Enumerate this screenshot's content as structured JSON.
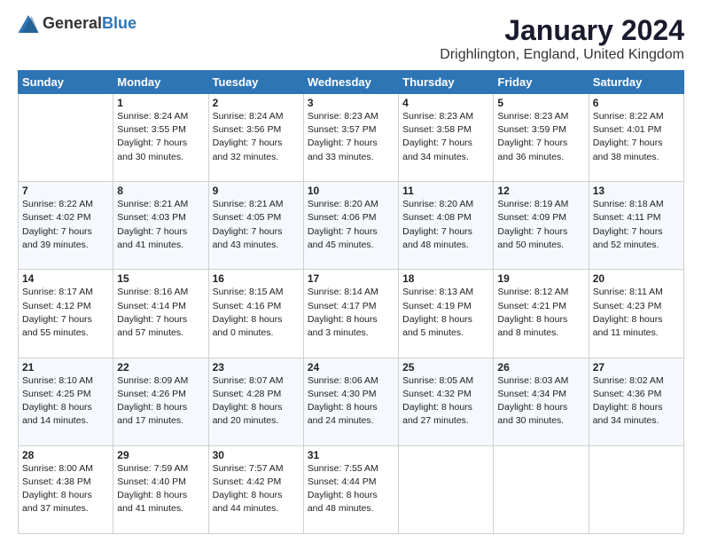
{
  "header": {
    "logo_general": "General",
    "logo_blue": "Blue",
    "month_title": "January 2024",
    "location": "Drighlington, England, United Kingdom"
  },
  "weekdays": [
    "Sunday",
    "Monday",
    "Tuesday",
    "Wednesday",
    "Thursday",
    "Friday",
    "Saturday"
  ],
  "weeks": [
    [
      {
        "day": "",
        "info": ""
      },
      {
        "day": "1",
        "info": "Sunrise: 8:24 AM\nSunset: 3:55 PM\nDaylight: 7 hours\nand 30 minutes."
      },
      {
        "day": "2",
        "info": "Sunrise: 8:24 AM\nSunset: 3:56 PM\nDaylight: 7 hours\nand 32 minutes."
      },
      {
        "day": "3",
        "info": "Sunrise: 8:23 AM\nSunset: 3:57 PM\nDaylight: 7 hours\nand 33 minutes."
      },
      {
        "day": "4",
        "info": "Sunrise: 8:23 AM\nSunset: 3:58 PM\nDaylight: 7 hours\nand 34 minutes."
      },
      {
        "day": "5",
        "info": "Sunrise: 8:23 AM\nSunset: 3:59 PM\nDaylight: 7 hours\nand 36 minutes."
      },
      {
        "day": "6",
        "info": "Sunrise: 8:22 AM\nSunset: 4:01 PM\nDaylight: 7 hours\nand 38 minutes."
      }
    ],
    [
      {
        "day": "7",
        "info": "Sunrise: 8:22 AM\nSunset: 4:02 PM\nDaylight: 7 hours\nand 39 minutes."
      },
      {
        "day": "8",
        "info": "Sunrise: 8:21 AM\nSunset: 4:03 PM\nDaylight: 7 hours\nand 41 minutes."
      },
      {
        "day": "9",
        "info": "Sunrise: 8:21 AM\nSunset: 4:05 PM\nDaylight: 7 hours\nand 43 minutes."
      },
      {
        "day": "10",
        "info": "Sunrise: 8:20 AM\nSunset: 4:06 PM\nDaylight: 7 hours\nand 45 minutes."
      },
      {
        "day": "11",
        "info": "Sunrise: 8:20 AM\nSunset: 4:08 PM\nDaylight: 7 hours\nand 48 minutes."
      },
      {
        "day": "12",
        "info": "Sunrise: 8:19 AM\nSunset: 4:09 PM\nDaylight: 7 hours\nand 50 minutes."
      },
      {
        "day": "13",
        "info": "Sunrise: 8:18 AM\nSunset: 4:11 PM\nDaylight: 7 hours\nand 52 minutes."
      }
    ],
    [
      {
        "day": "14",
        "info": "Sunrise: 8:17 AM\nSunset: 4:12 PM\nDaylight: 7 hours\nand 55 minutes."
      },
      {
        "day": "15",
        "info": "Sunrise: 8:16 AM\nSunset: 4:14 PM\nDaylight: 7 hours\nand 57 minutes."
      },
      {
        "day": "16",
        "info": "Sunrise: 8:15 AM\nSunset: 4:16 PM\nDaylight: 8 hours\nand 0 minutes."
      },
      {
        "day": "17",
        "info": "Sunrise: 8:14 AM\nSunset: 4:17 PM\nDaylight: 8 hours\nand 3 minutes."
      },
      {
        "day": "18",
        "info": "Sunrise: 8:13 AM\nSunset: 4:19 PM\nDaylight: 8 hours\nand 5 minutes."
      },
      {
        "day": "19",
        "info": "Sunrise: 8:12 AM\nSunset: 4:21 PM\nDaylight: 8 hours\nand 8 minutes."
      },
      {
        "day": "20",
        "info": "Sunrise: 8:11 AM\nSunset: 4:23 PM\nDaylight: 8 hours\nand 11 minutes."
      }
    ],
    [
      {
        "day": "21",
        "info": "Sunrise: 8:10 AM\nSunset: 4:25 PM\nDaylight: 8 hours\nand 14 minutes."
      },
      {
        "day": "22",
        "info": "Sunrise: 8:09 AM\nSunset: 4:26 PM\nDaylight: 8 hours\nand 17 minutes."
      },
      {
        "day": "23",
        "info": "Sunrise: 8:07 AM\nSunset: 4:28 PM\nDaylight: 8 hours\nand 20 minutes."
      },
      {
        "day": "24",
        "info": "Sunrise: 8:06 AM\nSunset: 4:30 PM\nDaylight: 8 hours\nand 24 minutes."
      },
      {
        "day": "25",
        "info": "Sunrise: 8:05 AM\nSunset: 4:32 PM\nDaylight: 8 hours\nand 27 minutes."
      },
      {
        "day": "26",
        "info": "Sunrise: 8:03 AM\nSunset: 4:34 PM\nDaylight: 8 hours\nand 30 minutes."
      },
      {
        "day": "27",
        "info": "Sunrise: 8:02 AM\nSunset: 4:36 PM\nDaylight: 8 hours\nand 34 minutes."
      }
    ],
    [
      {
        "day": "28",
        "info": "Sunrise: 8:00 AM\nSunset: 4:38 PM\nDaylight: 8 hours\nand 37 minutes."
      },
      {
        "day": "29",
        "info": "Sunrise: 7:59 AM\nSunset: 4:40 PM\nDaylight: 8 hours\nand 41 minutes."
      },
      {
        "day": "30",
        "info": "Sunrise: 7:57 AM\nSunset: 4:42 PM\nDaylight: 8 hours\nand 44 minutes."
      },
      {
        "day": "31",
        "info": "Sunrise: 7:55 AM\nSunset: 4:44 PM\nDaylight: 8 hours\nand 48 minutes."
      },
      {
        "day": "",
        "info": ""
      },
      {
        "day": "",
        "info": ""
      },
      {
        "day": "",
        "info": ""
      }
    ]
  ]
}
